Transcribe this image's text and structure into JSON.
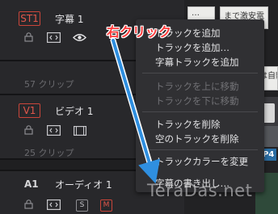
{
  "tracks": [
    {
      "badge": "ST1",
      "name": "字幕 1",
      "clips": "57 クリップ"
    },
    {
      "badge": "V1",
      "name": "ビデオ 1",
      "clips": "25 クリップ"
    },
    {
      "badge": "A1",
      "name": "オーディオ 1",
      "buttons": [
        "S",
        "M"
      ]
    }
  ],
  "timeline": {
    "thumb_top_left": "…",
    "thumb_top_right": "まで激安電",
    "thumb_mid_right": "は自動?",
    "clip_label": "P4"
  },
  "context_menu": {
    "items": [
      {
        "label": "トラックを追加",
        "enabled": true
      },
      {
        "label": "トラックを追加…",
        "enabled": true
      },
      {
        "label": "字幕トラックを追加",
        "enabled": true
      },
      {
        "label": "トラックを上に移動",
        "enabled": false
      },
      {
        "label": "トラックを下に移動",
        "enabled": false
      },
      {
        "label": "トラックを削除",
        "enabled": true
      },
      {
        "label": "空のトラックを削除",
        "enabled": true
      },
      {
        "label": "トラックカラーを変更",
        "enabled": true
      },
      {
        "label": "字幕の書き出し…",
        "enabled": true
      }
    ]
  },
  "annotation": {
    "text": "右クリック",
    "color": "#ff3b3b"
  },
  "watermark": "TeraDas.net",
  "colors": {
    "accent_red": "#c9453a",
    "panel": "#28282b",
    "menu": "#303033",
    "arrow": "#2f8fe0"
  }
}
